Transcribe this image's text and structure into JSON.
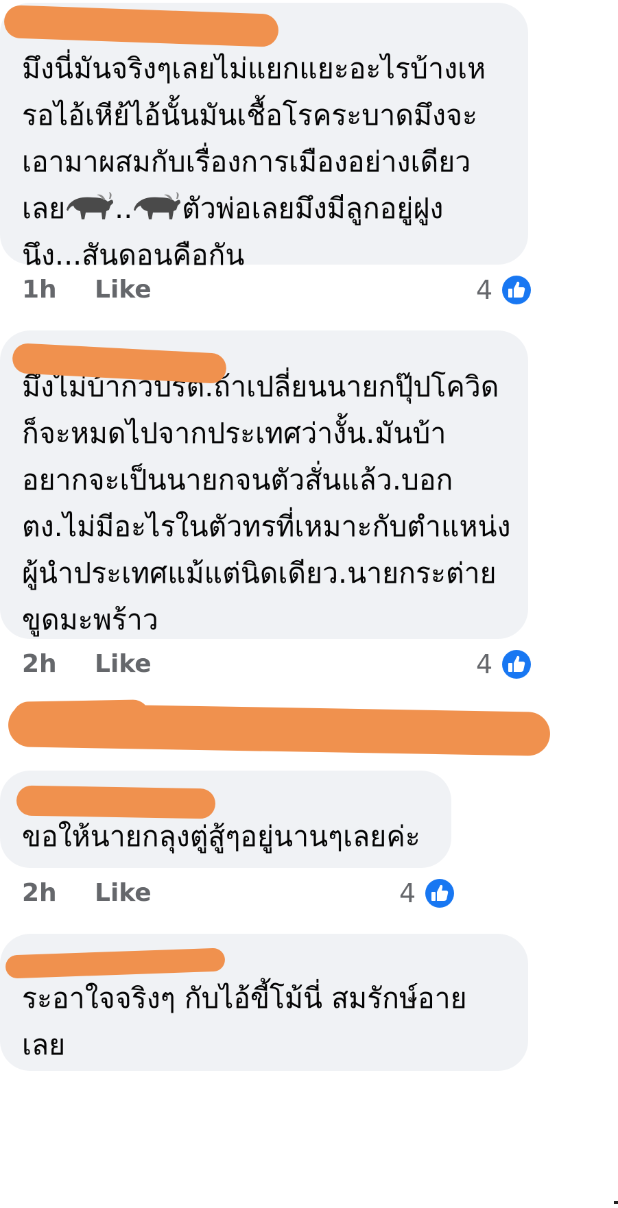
{
  "comments": [
    {
      "name": "",
      "text_a": "มึงนี่มันจริงๆเลยไม่แยกแยะอะไรบ้างเห\nรอไอ้เหีย้ไอ้นั้นมันเชื้อโรคระบาดมึงจะ\nเอามาผสมกับเรื่องการเมืองอย่างเดียว\nเลย",
      "text_b": "..",
      "text_c": "ตัวพ่อเลยมึงมีลูกอยู่ฝูง\nนึง...สันดอนคือกัน",
      "time": "1h",
      "like_label": "Like",
      "reaction_count": "4"
    },
    {
      "name": "",
      "text": "มึงไม่บ้าก็วิปริต.ถ้าเปลี่ยนนายกปุ๊ปโควิด\nก็จะหมดไปจากประเทศว่างั้น.มันบ้า\nอยากจะเป็นนายกจนตัวสั่นแล้ว.บอก\nตง.ไม่มีอะไรในตัวทรที่เหมาะกับตำแหน่ง\nผู้นำประเทศแม้แต่นิดเดียว.นายกระต่าย\nขูดมะพร้าว",
      "time": "2h",
      "like_label": "Like",
      "reaction_count": "4"
    },
    {
      "name": "",
      "text": "ขอให้นายกลุงตู่สู้ๆอยู่นานๆเลยค่ะ",
      "time": "2h",
      "like_label": "Like",
      "reaction_count": "4"
    },
    {
      "name": "",
      "text": "ระอาใจจริงๆ กับไอ้ขี้โม้นี่ สมรักษ์อาย\nเลย"
    }
  ],
  "icons": {
    "like_reaction": "thumbs-up-icon",
    "emoji": "water-buffalo-icon"
  },
  "colors": {
    "bubble": "#f0f2f5",
    "meta_text": "#65676b",
    "like_blue": "#1877f2",
    "redaction": "#f0914e"
  }
}
